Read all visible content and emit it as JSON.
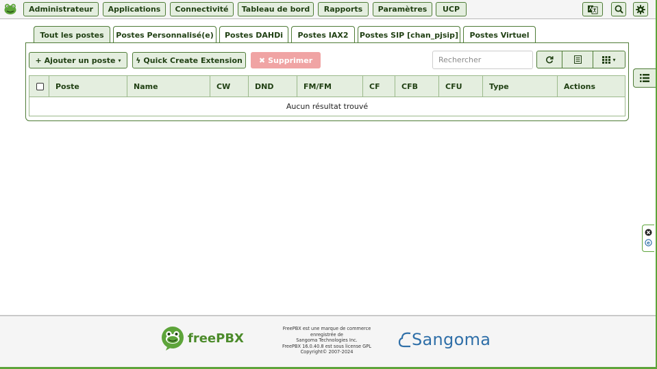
{
  "nav": {
    "items": [
      "Administrateur",
      "Applications",
      "Connectivité",
      "Tableau de bord",
      "Rapports",
      "Paramètres",
      "UCP"
    ],
    "icons": [
      "language-icon",
      "search-icon",
      "gear-icon"
    ]
  },
  "tabs": [
    "Tout les postes",
    "Postes Personnalisé(e)",
    "Postes DAHDi",
    "Postes IAX2",
    "Postes SIP [chan_pjsip]",
    "Postes Virtuel"
  ],
  "active_tab": "Tout les postes",
  "toolbar": {
    "add_label": "Ajouter un poste",
    "quick_create_label": "Quick Create Extension",
    "delete_label": "Supprimer",
    "search_placeholder": "Rechercher"
  },
  "table": {
    "columns": [
      "Poste",
      "Name",
      "CW",
      "DND",
      "FM/FM",
      "CF",
      "CFB",
      "CFU",
      "Type",
      "Actions"
    ],
    "empty_message": "Aucun résultat trouvé"
  },
  "footer": {
    "brand": "freePBX",
    "legal_lines": [
      "FreePBX est une marque de commerce",
      "enregistrée de",
      "Sangoma Technologies Inc.",
      "FreePBX 16.0.40.8 est sous license GPL",
      "Copyright© 2007-2024"
    ],
    "sangoma": "Sangoma"
  },
  "colors": {
    "accent_green": "#4c7a34",
    "button_bg": "#e4eedf",
    "danger": "#f0a4a4",
    "sangoma_blue": "#2f6fa8"
  }
}
